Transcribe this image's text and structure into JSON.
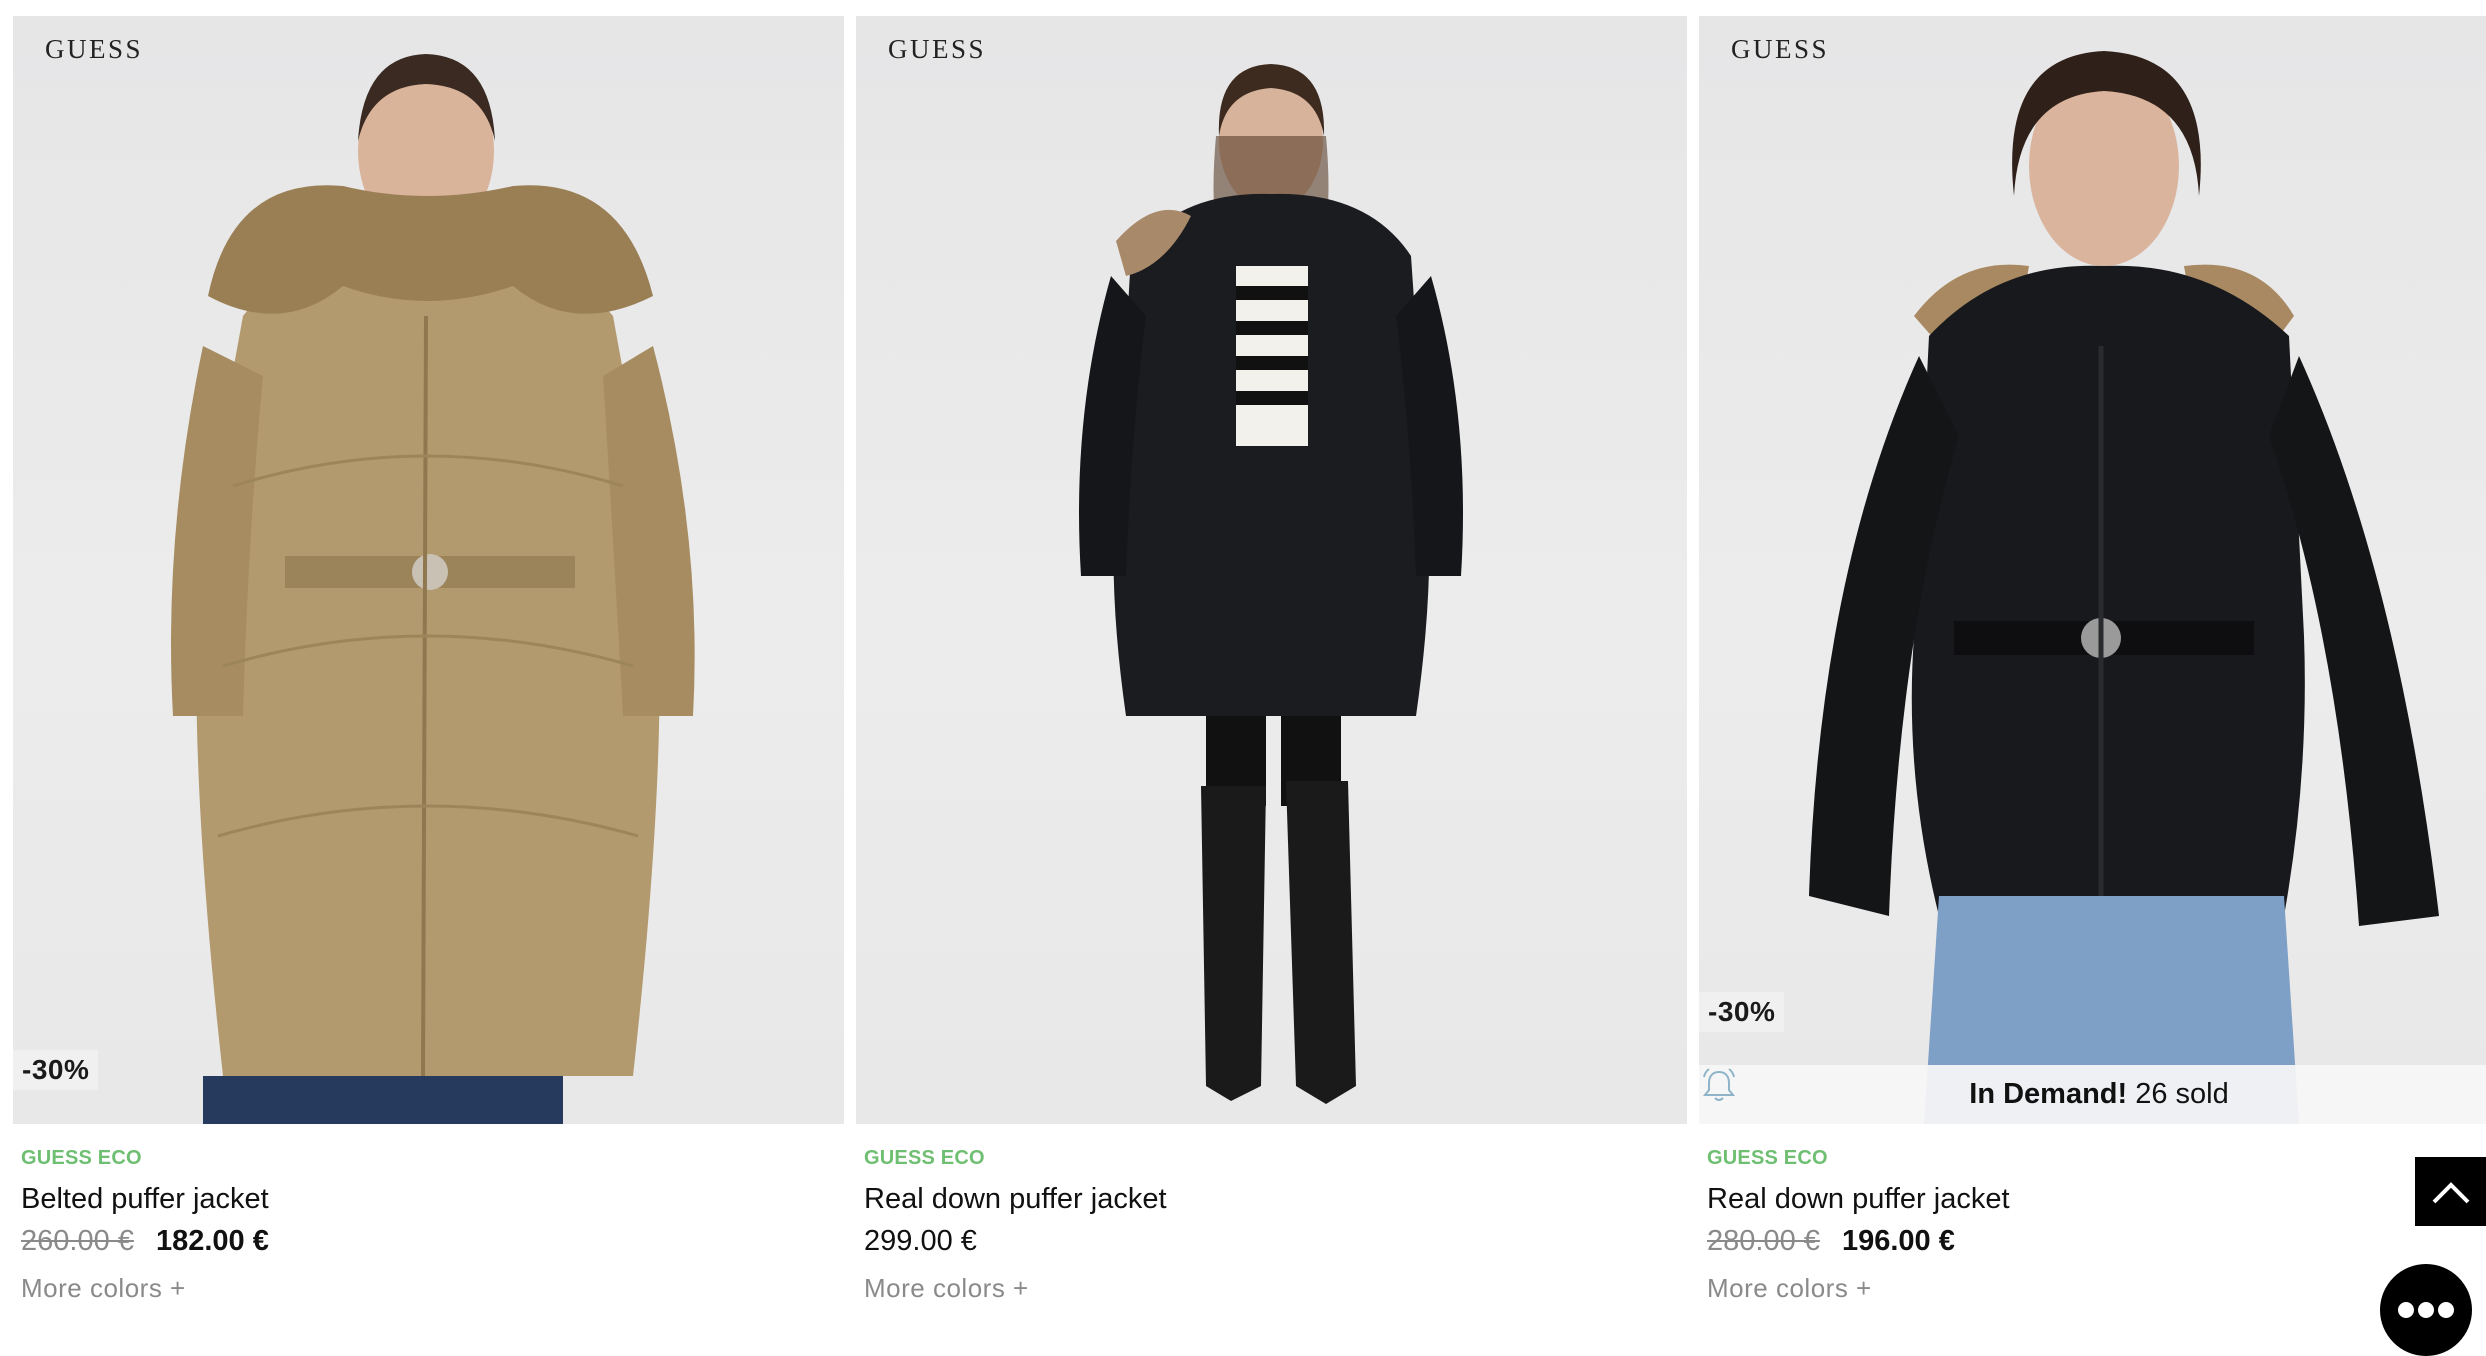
{
  "products": [
    {
      "brand_tag": "GUESS",
      "discount": "-30%",
      "line": "GUESS ECO",
      "name": "Belted puffer jacket",
      "old_price": "260.00 €",
      "price": "182.00 €",
      "more_colors": "More colors +",
      "jacket_color": "#b39a6e"
    },
    {
      "brand_tag": "GUESS",
      "line": "GUESS ECO",
      "name": "Real down puffer jacket",
      "price": "299.00 €",
      "more_colors": "More colors +",
      "jacket_color": "#1b1c1f"
    },
    {
      "brand_tag": "GUESS",
      "discount": "-30%",
      "demand_label": "In Demand!",
      "demand_count": "26 sold",
      "line": "GUESS ECO",
      "name": "Real down puffer jacket",
      "old_price": "280.00 €",
      "price": "196.00 €",
      "more_colors": "More colors +",
      "jacket_color": "#18191c"
    }
  ],
  "colors": {
    "eco_green": "#6fbf73",
    "strike_gray": "#8a8a8a",
    "photo_bg": "#e9e9ea"
  },
  "controls": {
    "back_to_top_icon": "chevron-up-icon",
    "chat_icon": "chat-bubble-icon"
  }
}
